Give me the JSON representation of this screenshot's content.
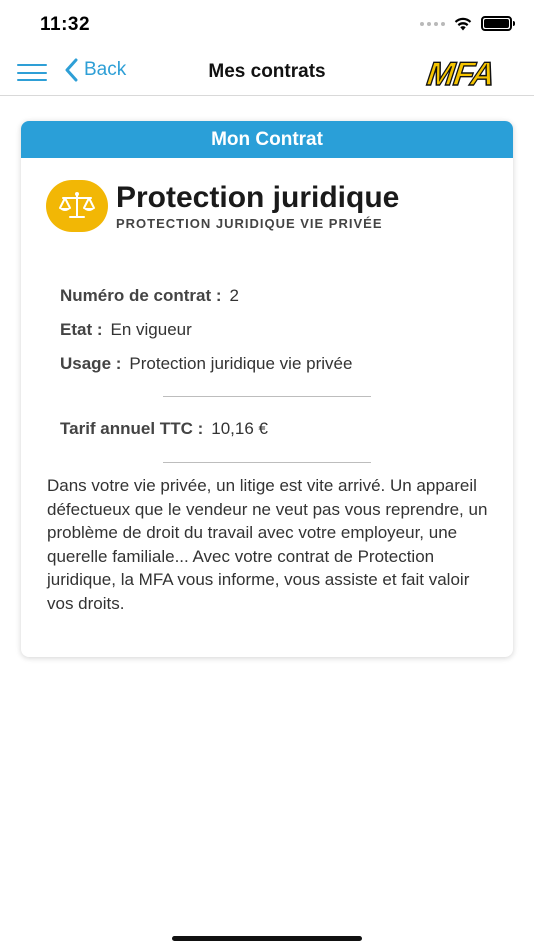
{
  "status_bar": {
    "time": "11:32",
    "wifi_icon": "wifi-icon",
    "battery_icon": "battery-icon",
    "battery_level": 1.0
  },
  "nav": {
    "menu_icon": "hamburger-menu-icon",
    "back_label": "Back",
    "back_icon": "chevron-left-icon",
    "title": "Mes contrats",
    "logo_text": "MFA"
  },
  "card": {
    "header": "Mon Contrat",
    "product_icon": "scales-of-justice-icon",
    "product_title": "Protection juridique",
    "product_subtitle": "PROTECTION JURIDIQUE VIE PRIVÉE",
    "fields": [
      {
        "label": "Numéro de contrat :",
        "value": "2"
      },
      {
        "label": "Etat :",
        "value": "En vigueur"
      },
      {
        "label": "Usage :",
        "value": "Protection juridique vie privée"
      }
    ],
    "tarif": {
      "label": "Tarif annuel TTC :",
      "value": "10,16 €"
    },
    "description": "Dans votre vie privée, un litige est vite arrivé. Un appareil défectueux que le vendeur ne veut pas vous reprendre, un problème de droit du travail avec votre employeur, une querelle familiale...  Avec votre contrat de Protection juridique, la MFA vous informe, vous assiste et fait valoir vos droits."
  },
  "colors": {
    "accent": "#2a9fd8",
    "logo_yellow": "#f5c400",
    "icon_yellow": "#f2b705"
  }
}
